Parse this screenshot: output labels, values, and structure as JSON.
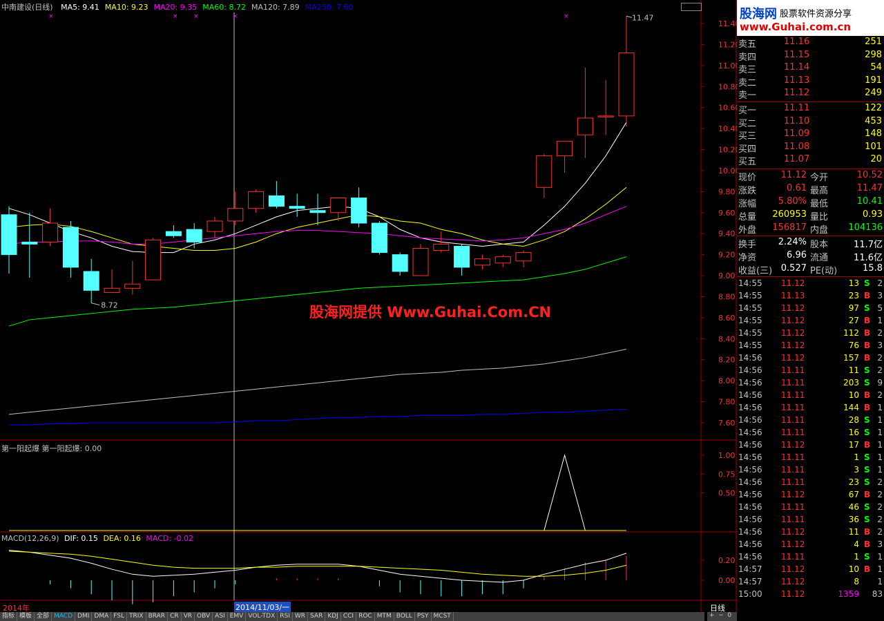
{
  "header": {
    "stock": "中南建设(日线)",
    "ma_items": [
      {
        "label": "MA5: 9.41",
        "color": "#ffffff"
      },
      {
        "label": "MA10: 9.23",
        "color": "#ffff00"
      },
      {
        "label": "MA20: 9.35",
        "color": "#ff00ff"
      },
      {
        "label": "MA60: 8.72",
        "color": "#00ff00"
      },
      {
        "label": "MA120: 7.89",
        "color": "#c0c0c0"
      },
      {
        "label": "MA250: 7.60",
        "color": "#0000ff"
      }
    ]
  },
  "price_axis": {
    "labels": [
      "11.40",
      "11.20",
      "11.00",
      "10.80",
      "10.60",
      "10.40",
      "10.20",
      "10.00",
      "9.80",
      "9.60",
      "9.40",
      "9.20",
      "9.00",
      "8.80",
      "8.60",
      "8.40",
      "8.20",
      "8.00",
      "7.80",
      "7.60"
    ],
    "high_marker": "11.47",
    "low_marker": "8.72"
  },
  "candles": [
    {
      "o": 9.58,
      "h": 9.66,
      "l": 9.02,
      "c": 9.2
    },
    {
      "o": 9.32,
      "h": 9.6,
      "l": 8.98,
      "c": 9.3
    },
    {
      "o": 9.32,
      "h": 9.64,
      "l": 9.28,
      "c": 9.5
    },
    {
      "o": 9.46,
      "h": 9.52,
      "l": 8.98,
      "c": 9.08
    },
    {
      "o": 9.04,
      "h": 9.16,
      "l": 8.74,
      "c": 8.86
    },
    {
      "o": 8.84,
      "h": 9.06,
      "l": 8.84,
      "c": 8.88
    },
    {
      "o": 8.88,
      "h": 9.14,
      "l": 8.82,
      "c": 8.92
    },
    {
      "o": 8.96,
      "h": 9.36,
      "l": 8.96,
      "c": 9.34
    },
    {
      "o": 9.42,
      "h": 9.48,
      "l": 9.36,
      "c": 9.38
    },
    {
      "o": 9.44,
      "h": 9.5,
      "l": 9.26,
      "c": 9.32
    },
    {
      "o": 9.42,
      "h": 9.56,
      "l": 9.36,
      "c": 9.52
    },
    {
      "o": 9.52,
      "h": 9.8,
      "l": 9.48,
      "c": 9.64
    },
    {
      "o": 9.64,
      "h": 9.82,
      "l": 9.6,
      "c": 9.8
    },
    {
      "o": 9.76,
      "h": 9.9,
      "l": 9.64,
      "c": 9.66
    },
    {
      "o": 9.66,
      "h": 9.78,
      "l": 9.56,
      "c": 9.64
    },
    {
      "o": 9.62,
      "h": 9.78,
      "l": 9.48,
      "c": 9.6
    },
    {
      "o": 9.6,
      "h": 9.74,
      "l": 9.52,
      "c": 9.74
    },
    {
      "o": 9.74,
      "h": 9.84,
      "l": 9.46,
      "c": 9.5
    },
    {
      "o": 9.5,
      "h": 9.52,
      "l": 9.2,
      "c": 9.22
    },
    {
      "o": 9.2,
      "h": 9.22,
      "l": 9.0,
      "c": 9.04
    },
    {
      "o": 9.0,
      "h": 9.3,
      "l": 9.0,
      "c": 9.26
    },
    {
      "o": 9.24,
      "h": 9.42,
      "l": 9.22,
      "c": 9.3
    },
    {
      "o": 9.28,
      "h": 9.3,
      "l": 9.0,
      "c": 9.08
    },
    {
      "o": 9.1,
      "h": 9.2,
      "l": 9.06,
      "c": 9.16
    },
    {
      "o": 9.12,
      "h": 9.2,
      "l": 9.08,
      "c": 9.18
    },
    {
      "o": 9.14,
      "h": 9.24,
      "l": 9.08,
      "c": 9.22
    },
    {
      "o": 9.84,
      "h": 10.16,
      "l": 9.74,
      "c": 10.14
    },
    {
      "o": 10.14,
      "h": 10.26,
      "l": 9.98,
      "c": 10.28
    },
    {
      "o": 10.34,
      "h": 10.98,
      "l": 10.12,
      "c": 10.5
    },
    {
      "o": 10.52,
      "h": 10.86,
      "l": 10.34,
      "c": 10.52
    },
    {
      "o": 10.52,
      "h": 11.47,
      "l": 10.42,
      "c": 11.12
    }
  ],
  "ma_lines": {
    "ma5": [
      9.64,
      9.58,
      9.5,
      9.42,
      9.36,
      9.28,
      9.23,
      9.22,
      9.22,
      9.3,
      9.34,
      9.4,
      9.48,
      9.56,
      9.62,
      9.64,
      9.66,
      9.64,
      9.56,
      9.44,
      9.36,
      9.32,
      9.3,
      9.28,
      9.3,
      9.32,
      9.48,
      9.66,
      9.88,
      10.14,
      10.46
    ],
    "ma10": [
      9.46,
      9.48,
      9.49,
      9.47,
      9.42,
      9.36,
      9.3,
      9.28,
      9.26,
      9.24,
      9.24,
      9.26,
      9.32,
      9.4,
      9.46,
      9.5,
      9.54,
      9.58,
      9.56,
      9.52,
      9.5,
      9.44,
      9.4,
      9.34,
      9.3,
      9.28,
      9.34,
      9.42,
      9.54,
      9.68,
      9.84
    ],
    "ma20": [
      9.3,
      9.32,
      9.32,
      9.33,
      9.33,
      9.32,
      9.3,
      9.3,
      9.32,
      9.34,
      9.36,
      9.38,
      9.4,
      9.42,
      9.43,
      9.43,
      9.42,
      9.41,
      9.4,
      9.38,
      9.36,
      9.35,
      9.34,
      9.33,
      9.34,
      9.36,
      9.4,
      9.44,
      9.5,
      9.58,
      9.66
    ],
    "ma60": [
      8.52,
      8.58,
      8.6,
      8.62,
      8.64,
      8.66,
      8.68,
      8.69,
      8.7,
      8.72,
      8.74,
      8.76,
      8.78,
      8.8,
      8.82,
      8.84,
      8.86,
      8.88,
      8.89,
      8.9,
      8.91,
      8.92,
      8.93,
      8.94,
      8.95,
      8.96,
      8.99,
      9.02,
      9.06,
      9.12,
      9.18
    ],
    "ma120": [
      7.68,
      7.7,
      7.72,
      7.74,
      7.76,
      7.78,
      7.8,
      7.82,
      7.84,
      7.86,
      7.88,
      7.9,
      7.92,
      7.94,
      7.96,
      7.98,
      8.0,
      8.02,
      8.04,
      8.06,
      8.07,
      8.08,
      8.1,
      8.11,
      8.12,
      8.14,
      8.16,
      8.19,
      8.22,
      8.26,
      8.3
    ],
    "ma250": [
      7.58,
      7.58,
      7.59,
      7.59,
      7.6,
      7.6,
      7.6,
      7.6,
      7.6,
      7.6,
      7.6,
      7.61,
      7.62,
      7.62,
      7.63,
      7.64,
      7.65,
      7.65,
      7.66,
      7.66,
      7.67,
      7.67,
      7.67,
      7.68,
      7.68,
      7.69,
      7.7,
      7.7,
      7.71,
      7.72,
      7.73
    ]
  },
  "indicator1": {
    "title": "第一阳起爆  第一阳起爆: 0.00",
    "axis_labels": [
      "1.00",
      "0.75",
      "0.50"
    ],
    "values": [
      0,
      0,
      0,
      0,
      0,
      0,
      0,
      0,
      0,
      0,
      0,
      0,
      0,
      0,
      0,
      0,
      0,
      0,
      0,
      0,
      0,
      0,
      0,
      0,
      0,
      0,
      0,
      1,
      0,
      0,
      0
    ]
  },
  "macd": {
    "title_prefix": "MACD(12,26,9)",
    "dif": "DIF: 0.15",
    "dea": "DEA: 0.16",
    "macd": "MACD: -0.02",
    "axis_labels": [
      "0.20",
      "0.00"
    ],
    "dif_values": [
      0.3,
      0.28,
      0.25,
      0.22,
      0.17,
      0.11,
      0.06,
      0.04,
      0.05,
      0.06,
      0.08,
      0.1,
      0.13,
      0.15,
      0.16,
      0.16,
      0.16,
      0.14,
      0.1,
      0.06,
      0.04,
      0.02,
      0.0,
      -0.01,
      -0.02,
      0.0,
      0.06,
      0.11,
      0.16,
      0.2,
      0.27
    ],
    "dea_values": [
      0.29,
      0.28,
      0.27,
      0.26,
      0.24,
      0.21,
      0.18,
      0.15,
      0.13,
      0.12,
      0.12,
      0.12,
      0.13,
      0.13,
      0.14,
      0.14,
      0.14,
      0.14,
      0.13,
      0.12,
      0.11,
      0.1,
      0.08,
      0.06,
      0.05,
      0.04,
      0.04,
      0.05,
      0.07,
      0.1,
      0.15
    ],
    "hist_values": [
      0.0,
      0.0,
      -0.04,
      -0.08,
      -0.14,
      -0.2,
      -0.24,
      -0.22,
      -0.16,
      -0.12,
      -0.08,
      -0.04,
      0.0,
      0.02,
      0.02,
      0.02,
      0.02,
      0.0,
      -0.06,
      -0.12,
      -0.14,
      -0.16,
      -0.16,
      -0.14,
      -0.14,
      -0.08,
      0.04,
      0.12,
      0.18,
      0.2,
      0.24
    ]
  },
  "time_axis": {
    "left": "2014年",
    "highlight": "2014/11/03/一",
    "period": "日线"
  },
  "quote": {
    "ask": [
      {
        "label": "卖五",
        "price": "11.16",
        "vol": "251"
      },
      {
        "label": "卖四",
        "price": "11.15",
        "vol": "298"
      },
      {
        "label": "卖三",
        "price": "11.14",
        "vol": "54"
      },
      {
        "label": "卖二",
        "price": "11.13",
        "vol": "191"
      },
      {
        "label": "卖一",
        "price": "11.12",
        "vol": "249"
      }
    ],
    "bid": [
      {
        "label": "买一",
        "price": "11.11",
        "vol": "122"
      },
      {
        "label": "买二",
        "price": "11.10",
        "vol": "453"
      },
      {
        "label": "买三",
        "price": "11.09",
        "vol": "148"
      },
      {
        "label": "买四",
        "price": "11.08",
        "vol": "101"
      },
      {
        "label": "买五",
        "price": "11.07",
        "vol": "20"
      }
    ]
  },
  "stats": [
    {
      "l1": "现价",
      "v1": "11.12",
      "c1": "#ff3030",
      "l2": "今开",
      "v2": "10.52",
      "c2": "#ff3030"
    },
    {
      "l1": "涨跌",
      "v1": "0.61",
      "c1": "#ff3030",
      "l2": "最高",
      "v2": "11.47",
      "c2": "#ff3030"
    },
    {
      "l1": "涨幅",
      "v1": "5.80%",
      "c1": "#ff3030",
      "l2": "最低",
      "v2": "10.41",
      "c2": "#00ff00"
    },
    {
      "l1": "总量",
      "v1": "260953",
      "c1": "#ffff00",
      "l2": "量比",
      "v2": "0.93",
      "c2": "#ffff00"
    },
    {
      "l1": "外盘",
      "v1": "156817",
      "c1": "#ff3030",
      "l2": "内盘",
      "v2": "104136",
      "c2": "#00ff00"
    },
    {
      "l1": "换手",
      "v1": "2.24%",
      "c1": "#ffffff",
      "l2": "股本",
      "v2": "11.7亿",
      "c2": "#ffffff"
    },
    {
      "l1": "净资",
      "v1": "6.96",
      "c1": "#ffffff",
      "l2": "流通",
      "v2": "11.6亿",
      "c2": "#ffffff"
    },
    {
      "l1": "收益(三)",
      "v1": "0.527",
      "c1": "#ffffff",
      "l2": "PE(动)",
      "v2": "15.8",
      "c2": "#ffffff"
    }
  ],
  "ticks": [
    {
      "t": "14:55",
      "p": "11.12",
      "v": "13",
      "bs": "S",
      "n": "2"
    },
    {
      "t": "14:55",
      "p": "11.13",
      "v": "23",
      "bs": "B",
      "n": "3"
    },
    {
      "t": "14:55",
      "p": "11.12",
      "v": "97",
      "bs": "S",
      "n": "5"
    },
    {
      "t": "14:55",
      "p": "11.12",
      "v": "27",
      "bs": "B",
      "n": "1"
    },
    {
      "t": "14:55",
      "p": "11.12",
      "v": "112",
      "bs": "B",
      "n": "2"
    },
    {
      "t": "14:55",
      "p": "11.12",
      "v": "76",
      "bs": "B",
      "n": "3"
    },
    {
      "t": "14:56",
      "p": "11.12",
      "v": "157",
      "bs": "B",
      "n": "2"
    },
    {
      "t": "14:56",
      "p": "11.11",
      "v": "11",
      "bs": "S",
      "n": "2"
    },
    {
      "t": "14:56",
      "p": "11.11",
      "v": "203",
      "bs": "S",
      "n": "9"
    },
    {
      "t": "14:56",
      "p": "11.11",
      "v": "10",
      "bs": "B",
      "n": "2"
    },
    {
      "t": "14:56",
      "p": "11.11",
      "v": "144",
      "bs": "B",
      "n": "1"
    },
    {
      "t": "14:56",
      "p": "11.11",
      "v": "28",
      "bs": "S",
      "n": "1"
    },
    {
      "t": "14:56",
      "p": "11.11",
      "v": "16",
      "bs": "S",
      "n": "1"
    },
    {
      "t": "14:56",
      "p": "11.12",
      "v": "17",
      "bs": "B",
      "n": "1"
    },
    {
      "t": "14:56",
      "p": "11.11",
      "v": "1",
      "bs": "S",
      "n": "1"
    },
    {
      "t": "14:56",
      "p": "11.11",
      "v": "3",
      "bs": "S",
      "n": "1"
    },
    {
      "t": "14:56",
      "p": "11.11",
      "v": "23",
      "bs": "S",
      "n": "2"
    },
    {
      "t": "14:56",
      "p": "11.12",
      "v": "67",
      "bs": "B",
      "n": "2"
    },
    {
      "t": "14:56",
      "p": "11.11",
      "v": "46",
      "bs": "S",
      "n": "2"
    },
    {
      "t": "14:56",
      "p": "11.11",
      "v": "36",
      "bs": "S",
      "n": "2"
    },
    {
      "t": "14:56",
      "p": "11.12",
      "v": "11",
      "bs": "B",
      "n": "2"
    },
    {
      "t": "14:56",
      "p": "11.12",
      "v": "4",
      "bs": "B",
      "n": "3"
    },
    {
      "t": "14:56",
      "p": "11.11",
      "v": "1",
      "bs": "S",
      "n": "1"
    },
    {
      "t": "14:57",
      "p": "11.12",
      "v": "10",
      "bs": "B",
      "n": "1"
    },
    {
      "t": "14:57",
      "p": "11.12",
      "v": "8",
      "bs": "",
      "n": "1"
    },
    {
      "t": "15:00",
      "p": "11.12",
      "v": "1359",
      "bs": "",
      "n": "83"
    }
  ],
  "tabs": [
    "指标",
    "模板",
    "全部",
    "MACD",
    "DMI",
    "DMA",
    "FSL",
    "TRIX",
    "BRAR",
    "CR",
    "VR",
    "OBV",
    "ASI",
    "EMV",
    "VOL-TDX",
    "RSI",
    "WR",
    "SAR",
    "KDJ",
    "CCI",
    "ROC",
    "MTM",
    "BOLL",
    "PSY",
    "MCST"
  ],
  "logo": {
    "title": "股海网",
    "tagline": "股票软件资源分享",
    "url": "www.Guhai.com.cn"
  },
  "watermark": "股海网提供 Www.Guhai.Com.CN",
  "colors": {
    "up": "#ff3030",
    "down": "#54ffff",
    "border": "#a00000"
  }
}
